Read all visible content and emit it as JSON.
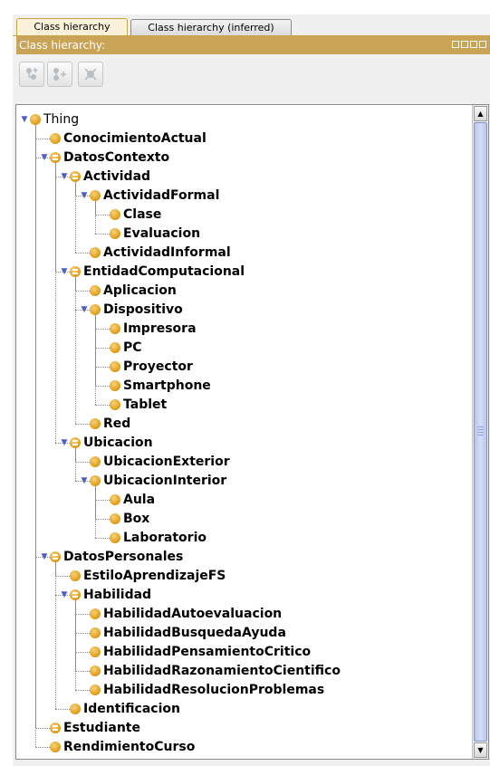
{
  "tabs": [
    {
      "label": "Class hierarchy",
      "active": true
    },
    {
      "label": "Class hierarchy (inferred)",
      "active": false
    }
  ],
  "panel": {
    "title": "Class hierarchy:",
    "header_color": "#c9a356"
  },
  "toolbar": {
    "buttons": [
      {
        "icon": "add-subclass-icon"
      },
      {
        "icon": "add-sibling-class-icon"
      },
      {
        "icon": "delete-class-icon"
      }
    ]
  },
  "tree": [
    {
      "label": "Thing",
      "depth": 0,
      "expanded": true,
      "defined": false
    },
    {
      "label": "ConocimientoActual",
      "depth": 1,
      "defined": false
    },
    {
      "label": "DatosContexto",
      "depth": 1,
      "expanded": true,
      "defined": true
    },
    {
      "label": "Actividad",
      "depth": 2,
      "expanded": true,
      "defined": true
    },
    {
      "label": "ActividadFormal",
      "depth": 3,
      "expanded": true,
      "defined": false
    },
    {
      "label": "Clase",
      "depth": 4,
      "defined": false
    },
    {
      "label": "Evaluacion",
      "depth": 4,
      "defined": false
    },
    {
      "label": "ActividadInformal",
      "depth": 3,
      "defined": false
    },
    {
      "label": "EntidadComputacional",
      "depth": 2,
      "expanded": true,
      "defined": true
    },
    {
      "label": "Aplicacion",
      "depth": 3,
      "defined": false
    },
    {
      "label": "Dispositivo",
      "depth": 3,
      "expanded": true,
      "defined": false
    },
    {
      "label": "Impresora",
      "depth": 4,
      "defined": false
    },
    {
      "label": "PC",
      "depth": 4,
      "defined": false
    },
    {
      "label": "Proyector",
      "depth": 4,
      "defined": false
    },
    {
      "label": "Smartphone",
      "depth": 4,
      "defined": false
    },
    {
      "label": "Tablet",
      "depth": 4,
      "defined": false
    },
    {
      "label": "Red",
      "depth": 3,
      "defined": false
    },
    {
      "label": "Ubicacion",
      "depth": 2,
      "expanded": true,
      "defined": true
    },
    {
      "label": "UbicacionExterior",
      "depth": 3,
      "defined": false
    },
    {
      "label": "UbicacionInterior",
      "depth": 3,
      "expanded": true,
      "defined": false
    },
    {
      "label": "Aula",
      "depth": 4,
      "defined": false
    },
    {
      "label": "Box",
      "depth": 4,
      "defined": false
    },
    {
      "label": "Laboratorio",
      "depth": 4,
      "defined": false
    },
    {
      "label": "DatosPersonales",
      "depth": 1,
      "expanded": true,
      "defined": true
    },
    {
      "label": "EstiloAprendizajeFS",
      "depth": 2,
      "defined": false
    },
    {
      "label": "Habilidad",
      "depth": 2,
      "expanded": true,
      "defined": true
    },
    {
      "label": "HabilidadAutoevaluacion",
      "depth": 3,
      "defined": false
    },
    {
      "label": "HabilidadBusquedaAyuda",
      "depth": 3,
      "defined": false
    },
    {
      "label": "HabilidadPensamientoCritico",
      "depth": 3,
      "defined": false
    },
    {
      "label": "HabilidadRazonamientoCientifico",
      "depth": 3,
      "defined": false
    },
    {
      "label": "HabilidadResolucionProblemas",
      "depth": 3,
      "defined": false
    },
    {
      "label": "Identificacion",
      "depth": 2,
      "defined": false
    },
    {
      "label": "Estudiante",
      "depth": 1,
      "defined": true
    },
    {
      "label": "RendimientoCurso",
      "depth": 1,
      "defined": false
    }
  ]
}
